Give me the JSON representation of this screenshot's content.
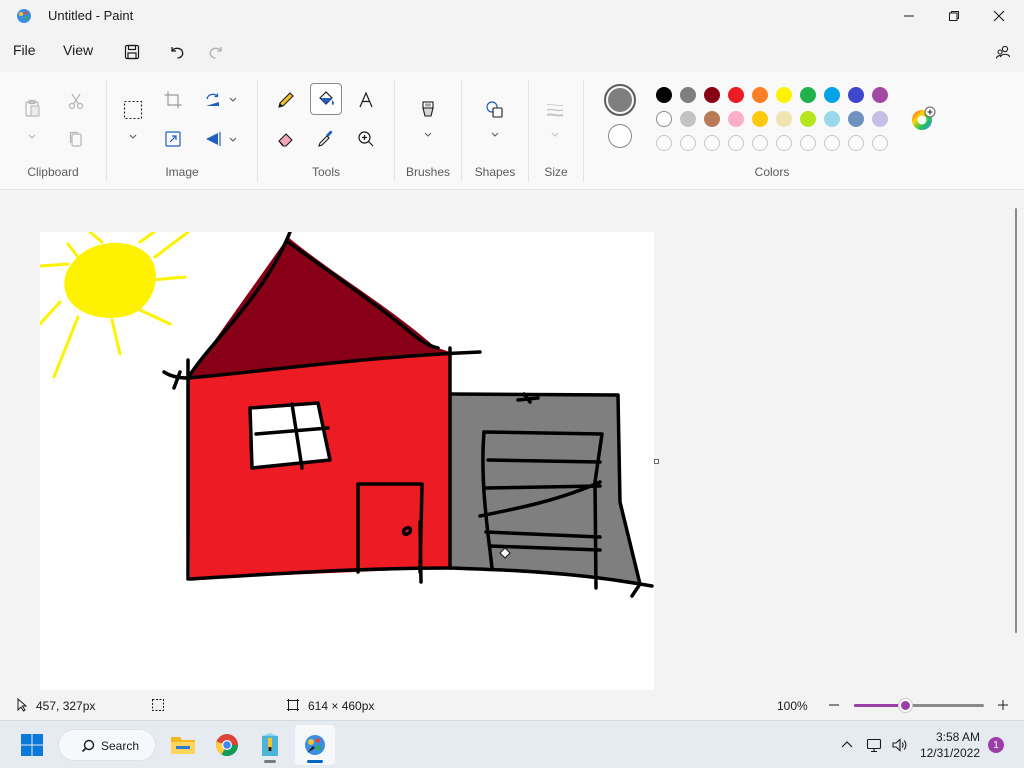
{
  "window": {
    "title": "Untitled - Paint"
  },
  "menu": {
    "file": "File",
    "view": "View"
  },
  "ribbon": {
    "groups": {
      "clipboard": "Clipboard",
      "image": "Image",
      "tools": "Tools",
      "brushes": "Brushes",
      "shapes": "Shapes",
      "size": "Size",
      "colors": "Colors"
    },
    "selected_tool": "fill",
    "primary_color": "#7f7f7f",
    "secondary_color": "#ffffff"
  },
  "palette": [
    [
      "#000000",
      "#7f7f7f",
      "#880015",
      "#ed1c24",
      "#ff7f27",
      "#fff200",
      "#22b14c",
      "#00a2e8",
      "#3f48cc",
      "#a349a4"
    ],
    [
      "#ffffff",
      "#c3c3c3",
      "#b97a57",
      "#ffaec9",
      "#ffc90e",
      "#efe4b0",
      "#b5e61d",
      "#99d9ea",
      "#7092be",
      "#c8bfe7"
    ],
    [
      "",
      "",
      "",
      "",
      "",
      "",
      "",
      "",
      "",
      ""
    ]
  ],
  "status": {
    "cursor_position": "457, 327px",
    "canvas_size": "614 × 460px",
    "zoom": "100%",
    "zoom_fraction": 0.39
  },
  "taskbar": {
    "search_label": "Search",
    "time": "3:58 AM",
    "date": "12/31/2022",
    "notification_count": "1"
  }
}
